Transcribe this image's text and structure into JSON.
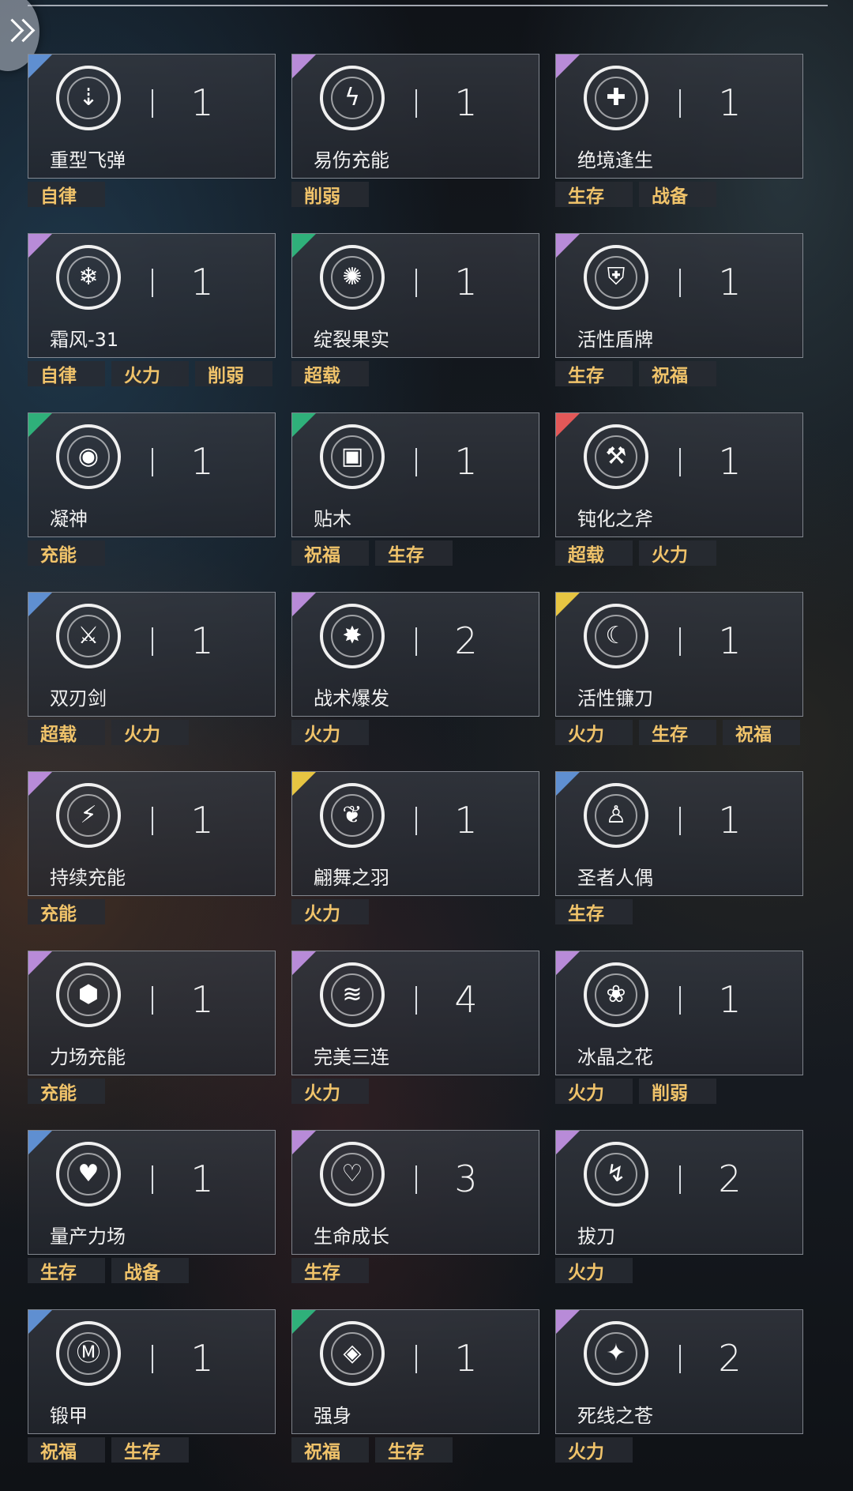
{
  "colors": {
    "blue": "#5f8fd1",
    "purple": "#b88bd8",
    "green": "#2fb07a",
    "red": "#e35858",
    "yellow": "#e7c542",
    "tag_text": "#f0c36a"
  },
  "cards": [
    {
      "name": "重型飞弹",
      "count": "1",
      "rarity": "blue",
      "icon": "missile-icon",
      "glyph": "⇣",
      "tags": [
        "自律"
      ]
    },
    {
      "name": "易伤充能",
      "count": "1",
      "rarity": "purple",
      "icon": "shield-bolt-icon",
      "glyph": "ϟ",
      "tags": [
        "削弱"
      ]
    },
    {
      "name": "绝境逢生",
      "count": "1",
      "rarity": "purple",
      "icon": "revive-figure-icon",
      "glyph": "✚",
      "tags": [
        "生存",
        "战备"
      ]
    },
    {
      "name": "霜风-31",
      "count": "1",
      "rarity": "purple",
      "icon": "frost-turret-icon",
      "glyph": "❄",
      "tags": [
        "自律",
        "火力",
        "削弱"
      ]
    },
    {
      "name": "绽裂果实",
      "count": "1",
      "rarity": "green",
      "icon": "burst-fruit-icon",
      "glyph": "✺",
      "tags": [
        "超载"
      ]
    },
    {
      "name": "活性盾牌",
      "count": "1",
      "rarity": "purple",
      "icon": "shield-icon",
      "glyph": "⛨",
      "tags": [
        "生存",
        "祝福"
      ]
    },
    {
      "name": "凝神",
      "count": "1",
      "rarity": "green",
      "icon": "eye-icon",
      "glyph": "◉",
      "tags": [
        "充能"
      ]
    },
    {
      "name": "贴木",
      "count": "1",
      "rarity": "green",
      "icon": "barrier-icon",
      "glyph": "▣",
      "tags": [
        "祝福",
        "生存"
      ]
    },
    {
      "name": "钝化之斧",
      "count": "1",
      "rarity": "red",
      "icon": "axe-icon",
      "glyph": "⚒",
      "tags": [
        "超载",
        "火力"
      ]
    },
    {
      "name": "双刃剑",
      "count": "1",
      "rarity": "blue",
      "icon": "double-blade-icon",
      "glyph": "⚔",
      "tags": [
        "超载",
        "火力"
      ]
    },
    {
      "name": "战术爆发",
      "count": "2",
      "rarity": "purple",
      "icon": "burst-icon",
      "glyph": "✸",
      "tags": [
        "火力"
      ]
    },
    {
      "name": "活性镰刀",
      "count": "1",
      "rarity": "yellow",
      "icon": "scythe-icon",
      "glyph": "☾",
      "tags": [
        "火力",
        "生存",
        "祝福"
      ]
    },
    {
      "name": "持续充能",
      "count": "1",
      "rarity": "purple",
      "icon": "battery-icon",
      "glyph": "⚡",
      "tags": [
        "充能"
      ]
    },
    {
      "name": "翩舞之羽",
      "count": "1",
      "rarity": "yellow",
      "icon": "feather-icon",
      "glyph": "❦",
      "tags": [
        "火力"
      ]
    },
    {
      "name": "圣者人偶",
      "count": "1",
      "rarity": "blue",
      "icon": "saint-doll-icon",
      "glyph": "♙",
      "tags": [
        "生存"
      ]
    },
    {
      "name": "力场充能",
      "count": "1",
      "rarity": "purple",
      "icon": "hex-field-icon",
      "glyph": "⬢",
      "tags": [
        "充能"
      ]
    },
    {
      "name": "完美三连",
      "count": "4",
      "rarity": "purple",
      "icon": "triple-slash-icon",
      "glyph": "≋",
      "tags": [
        "火力"
      ]
    },
    {
      "name": "冰晶之花",
      "count": "1",
      "rarity": "purple",
      "icon": "ice-flower-icon",
      "glyph": "❀",
      "tags": [
        "火力",
        "削弱"
      ]
    },
    {
      "name": "量产力场",
      "count": "1",
      "rarity": "blue",
      "icon": "heart-hex-icon",
      "glyph": "♥",
      "tags": [
        "生存",
        "战备"
      ]
    },
    {
      "name": "生命成长",
      "count": "3",
      "rarity": "purple",
      "icon": "heart-pulse-icon",
      "glyph": "♡",
      "tags": [
        "生存"
      ]
    },
    {
      "name": "拔刀",
      "count": "2",
      "rarity": "purple",
      "icon": "draw-sword-icon",
      "glyph": "↯",
      "tags": [
        "火力"
      ]
    },
    {
      "name": "锻甲",
      "count": "1",
      "rarity": "blue",
      "icon": "forge-armor-icon",
      "glyph": "Ⓜ",
      "tags": [
        "祝福",
        "生存"
      ]
    },
    {
      "name": "强身",
      "count": "1",
      "rarity": "green",
      "icon": "diamond-chevron-icon",
      "glyph": "◈",
      "tags": [
        "祝福",
        "生存"
      ]
    },
    {
      "name": "死线之苍",
      "count": "2",
      "rarity": "purple",
      "icon": "deadline-star-icon",
      "glyph": "✦",
      "tags": [
        "火力"
      ]
    }
  ]
}
